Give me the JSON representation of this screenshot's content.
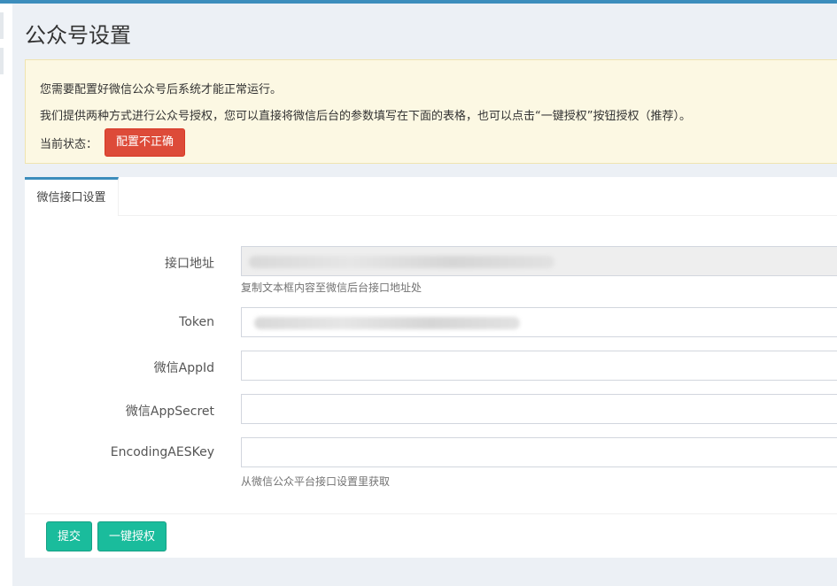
{
  "page": {
    "title": "公众号设置"
  },
  "notice": {
    "line1": "您需要配置好微信公众号后系统才能正常运行。",
    "line2": "我们提供两种方式进行公众号授权，您可以直接将微信后台的参数填写在下面的表格，也可以点击“一键授权”按钮授权（推荐）。",
    "status_label": "当前状态：",
    "status_value": "配置不正确"
  },
  "tabs": [
    {
      "label": "微信接口设置",
      "active": true
    }
  ],
  "form": {
    "url": {
      "label": "接口地址",
      "help": "复制文本框内容至微信后台接口地址处"
    },
    "token": {
      "label": "Token"
    },
    "appid": {
      "label": "微信AppId",
      "value": ""
    },
    "secret": {
      "label": "微信AppSecret",
      "value": ""
    },
    "aeskey": {
      "label": "EncodingAESKey",
      "value": "",
      "help": "从微信公众平台接口设置里获取"
    }
  },
  "buttons": {
    "submit": "提交",
    "authorize": "一键授权"
  },
  "colors": {
    "accent": "#3c8dbc",
    "danger": "#dd4b39",
    "success": "#1abc9c",
    "notice_bg": "#fcf8e3"
  }
}
